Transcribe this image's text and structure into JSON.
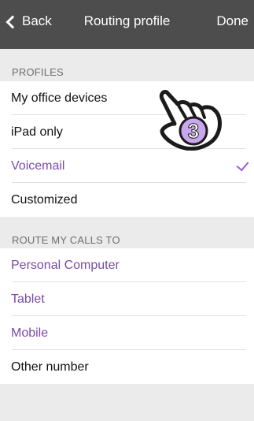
{
  "nav": {
    "back_label": "Back",
    "title": "Routing profile",
    "done_label": "Done"
  },
  "profiles": {
    "header": "PROFILES",
    "items": [
      {
        "label": "My office devices"
      },
      {
        "label": "iPad only"
      },
      {
        "label": "Voicemail",
        "selected": true
      },
      {
        "label": "Customized"
      }
    ]
  },
  "route": {
    "header": "ROUTE MY CALLS TO",
    "items": [
      {
        "label": "Personal Computer"
      },
      {
        "label": "Tablet"
      },
      {
        "label": "Mobile"
      },
      {
        "label": "Other number"
      }
    ]
  },
  "tutorial": {
    "step": "3"
  },
  "colors": {
    "nav": "#4d4d4d",
    "accent": "#7a4aa6",
    "background": "#ebebeb",
    "step_badge": "#c9a7ee"
  }
}
